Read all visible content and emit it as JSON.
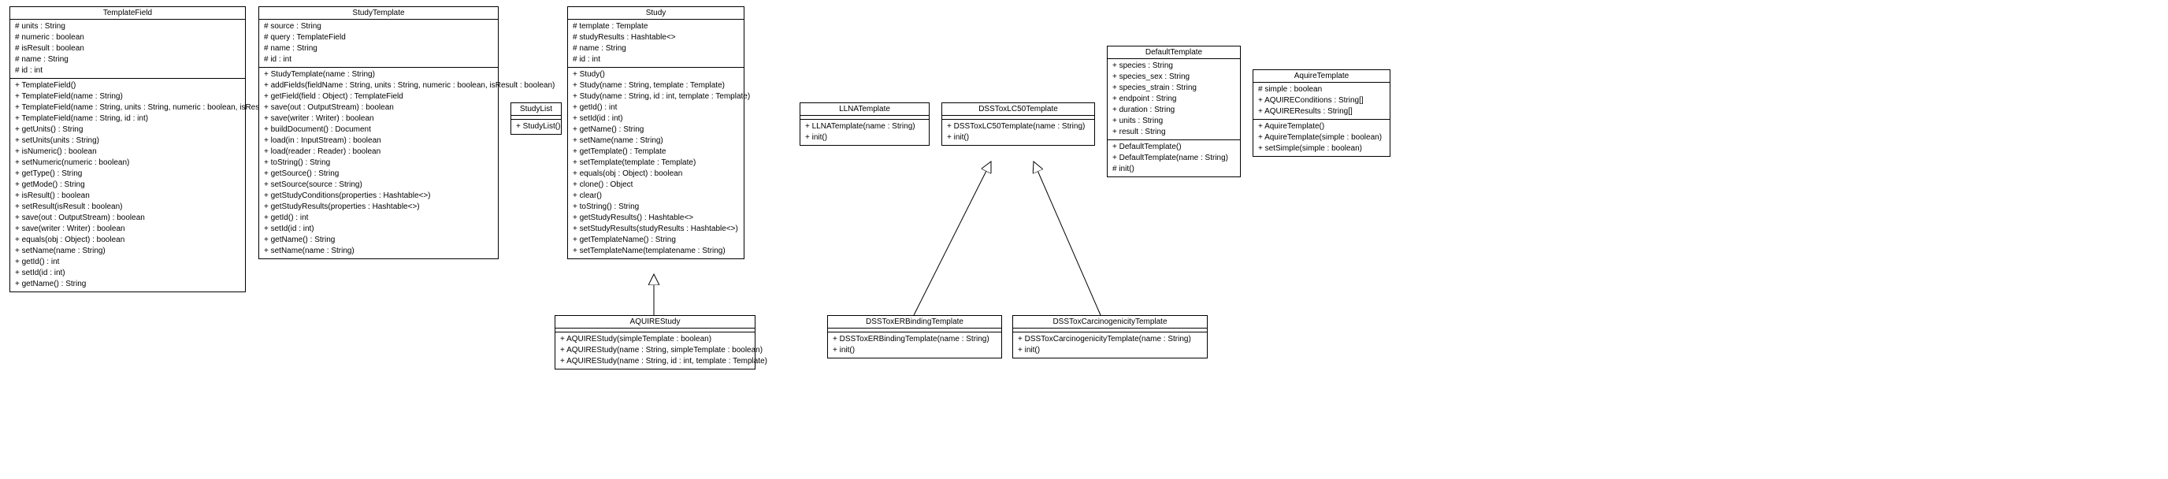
{
  "classes": {
    "TemplateField": {
      "name": "TemplateField",
      "attrs": [
        "# units : String",
        "# numeric : boolean",
        "# isResult : boolean",
        "# name : String",
        "# id : int"
      ],
      "ops": [
        "+ TemplateField()",
        "+ TemplateField(name : String)",
        "+ TemplateField(name : String, units : String, numeric : boolean, isResult : boolean)",
        "+ TemplateField(name : String, id : int)",
        "+ getUnits() : String",
        "+ setUnits(units : String)",
        "+ isNumeric() : boolean",
        "+ setNumeric(numeric : boolean)",
        "+ getType() : String",
        "+ getMode() : String",
        "+ isResult() : boolean",
        "+ setResult(isResult : boolean)",
        "+ save(out : OutputStream) : boolean",
        "+ save(writer : Writer) : boolean",
        "+ equals(obj : Object) : boolean",
        "+ setName(name : String)",
        "+ getId() : int",
        "+ setId(id : int)",
        "+ getName() : String"
      ]
    },
    "StudyTemplate": {
      "name": "StudyTemplate",
      "attrs": [
        "# source : String",
        "# query : TemplateField",
        "# name : String",
        "# id : int"
      ],
      "ops": [
        "+ StudyTemplate(name : String)",
        "+ addFields(fieldName : String, units : String, numeric : boolean, isResult : boolean)",
        "+ getField(field : Object) : TemplateField",
        "+ save(out : OutputStream) : boolean",
        "+ save(writer : Writer) : boolean",
        "+ buildDocument() : Document",
        "+ load(in : InputStream) : boolean",
        "+ load(reader : Reader) : boolean",
        "+ toString() : String",
        "+ getSource() : String",
        "+ setSource(source : String)",
        "+ getStudyConditions(properties : Hashtable<>)",
        "+ getStudyResults(properties : Hashtable<>)",
        "+ getId() : int",
        "+ setId(id : int)",
        "+ getName() : String",
        "+ setName(name : String)"
      ]
    },
    "StudyList": {
      "name": "StudyList",
      "attrs": [],
      "ops": [
        "+ StudyList()"
      ]
    },
    "Study": {
      "name": "Study",
      "attrs": [
        "# template : Template",
        "# studyResults : Hashtable<>",
        "# name : String",
        "# id : int"
      ],
      "ops": [
        "+ Study()",
        "+ Study(name : String, template : Template)",
        "+ Study(name : String, id : int, template : Template)",
        "+ getId() : int",
        "+ setId(id : int)",
        "+ getName() : String",
        "+ setName(name : String)",
        "+ getTemplate() : Template",
        "+ setTemplate(template : Template)",
        "+ equals(obj : Object) : boolean",
        "+ clone() : Object",
        "+ clear()",
        "+ toString() : String",
        "+ getStudyResults() : Hashtable<>",
        "+ setStudyResults(studyResults : Hashtable<>)",
        "+ getTemplateName() : String",
        "+ setTemplateName(templatename : String)"
      ]
    },
    "AQUIREStudy": {
      "name": "AQUIREStudy",
      "attrs": [],
      "ops": [
        "+ AQUIREStudy(simpleTemplate : boolean)",
        "+ AQUIREStudy(name : String, simpleTemplate : boolean)",
        "+ AQUIREStudy(name : String, id : int, template : Template)"
      ]
    },
    "LLNATemplate": {
      "name": "LLNATemplate",
      "attrs": [],
      "ops": [
        "+ LLNATemplate(name : String)",
        "+ init()"
      ]
    },
    "DSSToxLC50Template": {
      "name": "DSSToxLC50Template",
      "attrs": [],
      "ops": [
        "+ DSSToxLC50Template(name : String)",
        "+ init()"
      ]
    },
    "DSSToxERBindingTemplate": {
      "name": "DSSToxERBindingTemplate",
      "attrs": [],
      "ops": [
        "+ DSSToxERBindingTemplate(name : String)",
        "+ init()"
      ]
    },
    "DSSToxCarcinogenicityTemplate": {
      "name": "DSSToxCarcinogenicityTemplate",
      "attrs": [],
      "ops": [
        "+ DSSToxCarcinogenicityTemplate(name : String)",
        "+ init()"
      ]
    },
    "DefaultTemplate": {
      "name": "DefaultTemplate",
      "attrs": [
        "+ species : String",
        "+ species_sex : String",
        "+ species_strain : String",
        "+ endpoint : String",
        "+ duration : String",
        "+ units : String",
        "+ result : String"
      ],
      "ops": [
        "+ DefaultTemplate()",
        "+ DefaultTemplate(name : String)",
        "# init()"
      ]
    },
    "AquireTemplate": {
      "name": "AquireTemplate",
      "attrs": [
        "# simple : boolean",
        "+ AQUIREConditions : String[]",
        "+ AQUIREResults : String[]"
      ],
      "ops": [
        "+ AquireTemplate()",
        "+ AquireTemplate(simple : boolean)",
        "+ setSimple(simple : boolean)"
      ]
    }
  }
}
